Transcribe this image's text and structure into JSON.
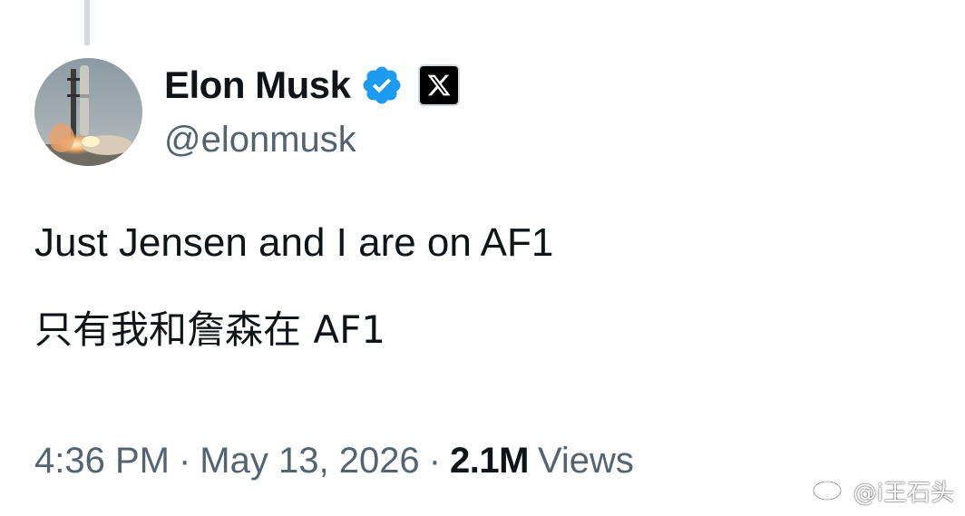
{
  "author": {
    "display_name": "Elon Musk",
    "handle": "@elonmusk",
    "verified_icon": "verified-badge-icon",
    "affiliate_icon": "x-logo-icon",
    "avatar": "starship-launch-avatar"
  },
  "tweet": {
    "line1": "Just Jensen and I are on AF1",
    "line2": "只有我和詹森在 AF1"
  },
  "meta": {
    "time": "4:36 PM",
    "separator": "·",
    "date": "May 13, 2026",
    "views_count": "2.1M",
    "views_label": "Views"
  },
  "watermark": {
    "icon": "weibo-logo-icon",
    "text": "@i王石头"
  },
  "colors": {
    "verified_blue": "#1d9bf0",
    "secondary_text": "#536471",
    "primary_text": "#0f1419",
    "thread_line": "#cfd9de"
  }
}
